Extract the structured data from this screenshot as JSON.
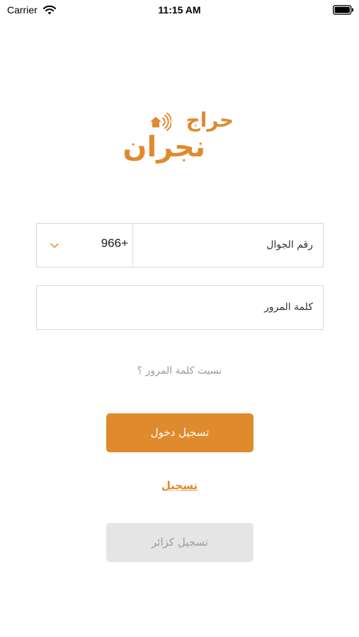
{
  "status_bar": {
    "carrier": "Carrier",
    "time": "11:15 AM",
    "icons": [
      "wifi-icon",
      "battery-icon"
    ]
  },
  "logo": {
    "word_top": "حراج",
    "word_bottom": "نجران",
    "icon": "house-signal-icon",
    "color": "#e08a2e"
  },
  "phone": {
    "country_code": "966+",
    "label": "رقم الجوال",
    "dropdown_icon": "chevron-down-icon"
  },
  "password": {
    "label": "كلمة المرور"
  },
  "forgot_password": "نسيت كلمة المرور ؟",
  "login_button": "تسجيل دخول",
  "register_link": "تسجيل",
  "guest_button": "تسجيل كزائر",
  "colors": {
    "accent": "#e08a2e",
    "guest_bg": "#e5e5e5",
    "muted_text": "#9b9b9b"
  }
}
